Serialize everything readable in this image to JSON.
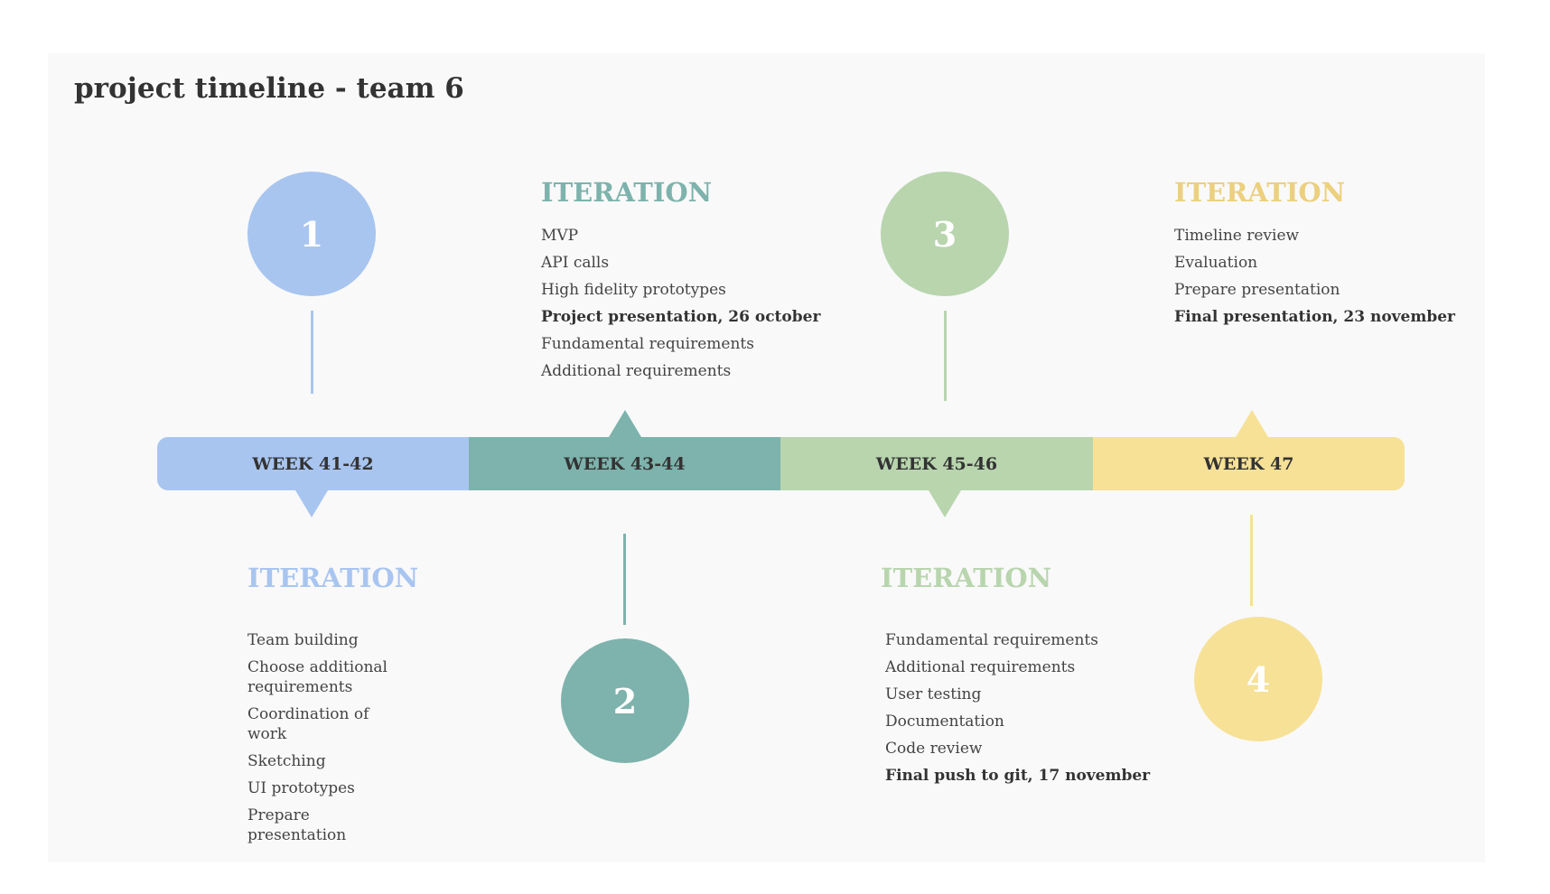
{
  "title": "project timeline - team 6",
  "colors": {
    "blue": "#a8c5f0",
    "teal": "#7db3ac",
    "green": "#b8d5ae",
    "yellow": "#f6e197",
    "background": "#f9f9f9"
  },
  "weeks": [
    "WEEK 41-42",
    "WEEK 43-44",
    "WEEK 45-46",
    "WEEK 47"
  ],
  "iterations": [
    {
      "number": "1",
      "heading": "ITERATION",
      "items": [
        "Team building",
        "Choose additional requirements",
        "Coordination of work",
        "Sketching",
        "UI prototypes",
        "Prepare presentation"
      ]
    },
    {
      "number": "2",
      "heading": "ITERATION",
      "items": [
        "MVP",
        "API calls",
        "High fidelity prototypes",
        "Project presentation, 26 october",
        "Fundamental requirements",
        "Additional requirements"
      ]
    },
    {
      "number": "3",
      "heading": "ITERATION",
      "items": [
        "Fundamental requirements",
        "Additional requirements",
        "User testing",
        "Documentation",
        "Code review",
        "Final push to git, 17 november"
      ]
    },
    {
      "number": "4",
      "heading": "ITERATION",
      "items": [
        "Timeline review",
        "Evaluation",
        "Prepare presentation",
        "Final presentation, 23 november"
      ]
    }
  ]
}
